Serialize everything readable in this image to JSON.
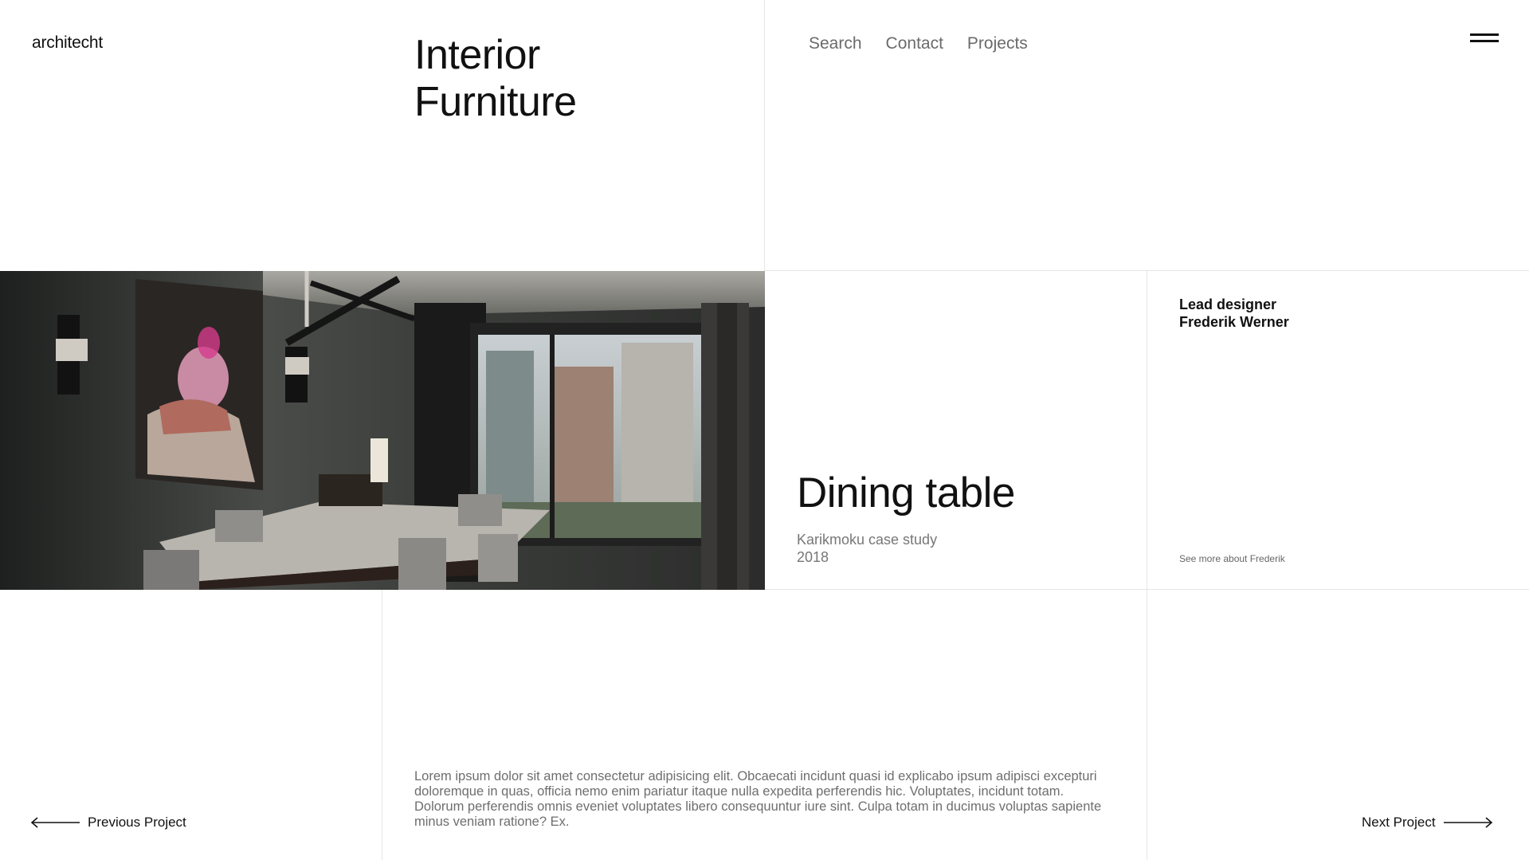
{
  "brand": {
    "name": "architecht"
  },
  "header": {
    "title_line1": "Interior",
    "title_line2": "Furniture"
  },
  "nav": {
    "items": [
      {
        "label": "Search"
      },
      {
        "label": "Contact"
      },
      {
        "label": "Projects"
      }
    ]
  },
  "project": {
    "title": "Dining table",
    "subtitle": "Karikmoku case study",
    "year": "2018"
  },
  "designer": {
    "role": "Lead designer",
    "name": "Frederik Werner",
    "link_label": "See more about Frederik"
  },
  "description": "Lorem ipsum dolor sit amet consectetur adipisicing elit. Obcaecati incidunt quasi id explicabo ipsum adipisci excepturi doloremque in quas, officia nemo enim pariatur itaque nulla expedita perferendis hic. Voluptates, incidunt totam. Dolorum perferendis omnis eveniet voluptates libero consequuntur iure sint. Culpa totam in ducimus voluptas sapiente minus veniam ratione? Ex.",
  "pager": {
    "prev_label": "Previous Project",
    "next_label": "Next Project"
  },
  "icons": {
    "menu": "hamburger-menu-icon",
    "prev": "arrow-left-icon",
    "next": "arrow-right-icon"
  },
  "colors": {
    "background": "#ffffff",
    "text": "#111111",
    "muted": "#6b6b6b",
    "grid_lines": "#e6e6e6"
  }
}
